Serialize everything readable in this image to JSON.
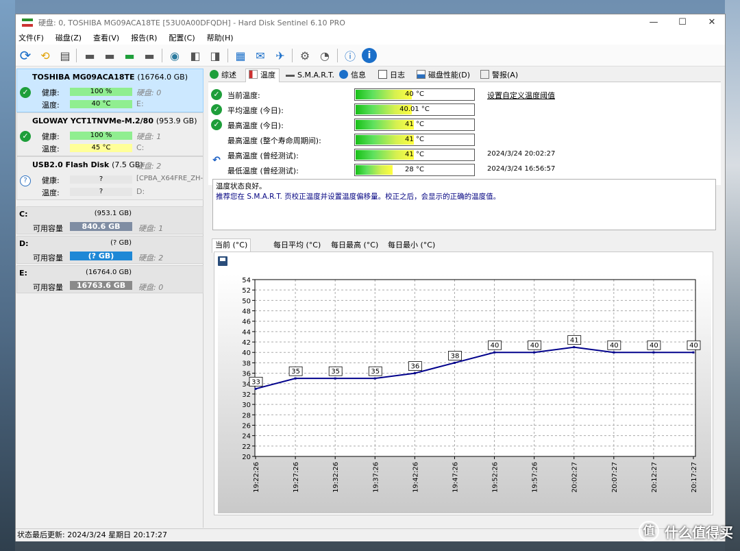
{
  "window": {
    "title": "硬盘:  0, TOSHIBA MG09ACA18TE [53U0A00DFQDH]  -  Hard Disk Sentinel 6.10 PRO"
  },
  "menu": [
    "文件(F)",
    "磁盘(Z)",
    "查看(V)",
    "报告(R)",
    "配置(C)",
    "帮助(H)"
  ],
  "disks": [
    {
      "name": "TOSHIBA MG09ACA18TE",
      "size": "(16764.0 GB)",
      "health_label": "健康:",
      "health": "100 %",
      "temp_label": "温度:",
      "temp": "40 °C",
      "hd1": "硬盘: 0",
      "hd2": "E:"
    },
    {
      "name": "GLOWAY YCT1TNVMe-M.2/80",
      "size": "(953.9 GB)",
      "health_label": "健康:",
      "health": "100 %",
      "temp_label": "温度:",
      "temp": "45 °C",
      "hd1": "硬盘: 1",
      "hd2": "C:"
    },
    {
      "name": "USB2.0  Flash Disk",
      "size": "(7.5 GB)",
      "hd0": "硬盘: 2",
      "health_label": "健康:",
      "health": "?",
      "temp_label": "温度:",
      "temp": "?",
      "hd1": "[CPBA_X64FRE_ZH-",
      "hd2": "D:"
    }
  ],
  "volumes": [
    {
      "name": "C:",
      "size": "(953.1 GB)",
      "label": "可用容量",
      "free": "840.6 GB",
      "disk": "硬盘: 1",
      "color": "#7f8da3",
      "pct": 88
    },
    {
      "name": "D:",
      "size": "(? GB)",
      "label": "可用容量",
      "free": "(? GB)",
      "disk": "硬盘: 2",
      "color": "#1e88d6",
      "pct": 100
    },
    {
      "name": "E:",
      "size": "(16764.0 GB)",
      "label": "可用容量",
      "free": "16763.6 GB",
      "disk": "硬盘: 0",
      "color": "#8a8a8a",
      "pct": 100
    }
  ],
  "tabs": [
    "综述",
    "温度",
    "S.M.A.R.T.",
    "信息",
    "日志",
    "磁盘性能(D)",
    "警报(A)"
  ],
  "temps": [
    {
      "label": "当前温度:",
      "value": "40 °C",
      "pct": 0.47
    },
    {
      "label": "平均温度 (今日):",
      "value": "40.01 °C",
      "pct": 0.47
    },
    {
      "label": "最高温度 (今日):",
      "value": "41 °C",
      "pct": 0.49
    },
    {
      "label": "最高温度 (整个寿命周期间):",
      "value": "41 °C",
      "pct": 0.49
    },
    {
      "label": "最高温度 (曾经测试):",
      "value": "41 °C",
      "pct": 0.49,
      "ts": "2024/3/24 20:02:27"
    },
    {
      "label": "最低温度 (曾经测试):",
      "value": "28 °C",
      "pct": 0.31,
      "ts": "2024/3/24 16:56:57"
    }
  ],
  "threshold_link": "设置自定义温度阈值",
  "message": {
    "line1": "温度状态良好。",
    "line2": "推荐您在 S.M.A.R.T. 页校正温度并设置温度偏移量。校正之后，会显示的正确的温度值。"
  },
  "chart_tabs": [
    "当前 (°C)",
    "每日平均 (°C)",
    "每日最高 (°C)",
    "每日最小 (°C)"
  ],
  "chart_data": {
    "type": "line",
    "x": [
      "19:22:26",
      "19:27:26",
      "19:32:26",
      "19:37:26",
      "19:42:26",
      "19:47:26",
      "19:52:26",
      "19:57:26",
      "20:02:27",
      "20:07:27",
      "20:12:27",
      "20:17:27"
    ],
    "values": [
      33,
      35,
      35,
      35,
      36,
      38,
      40,
      40,
      41,
      40,
      40,
      40
    ],
    "ylim": [
      20,
      54
    ],
    "yticks": [
      20,
      22,
      24,
      26,
      28,
      30,
      32,
      34,
      36,
      38,
      40,
      42,
      44,
      46,
      48,
      50,
      52,
      54
    ],
    "grid": true,
    "line_color": "#00008b"
  },
  "status": "状态最后更新:  2024/3/24 星期日 20:17:27",
  "watermark": "值 什么值得买"
}
